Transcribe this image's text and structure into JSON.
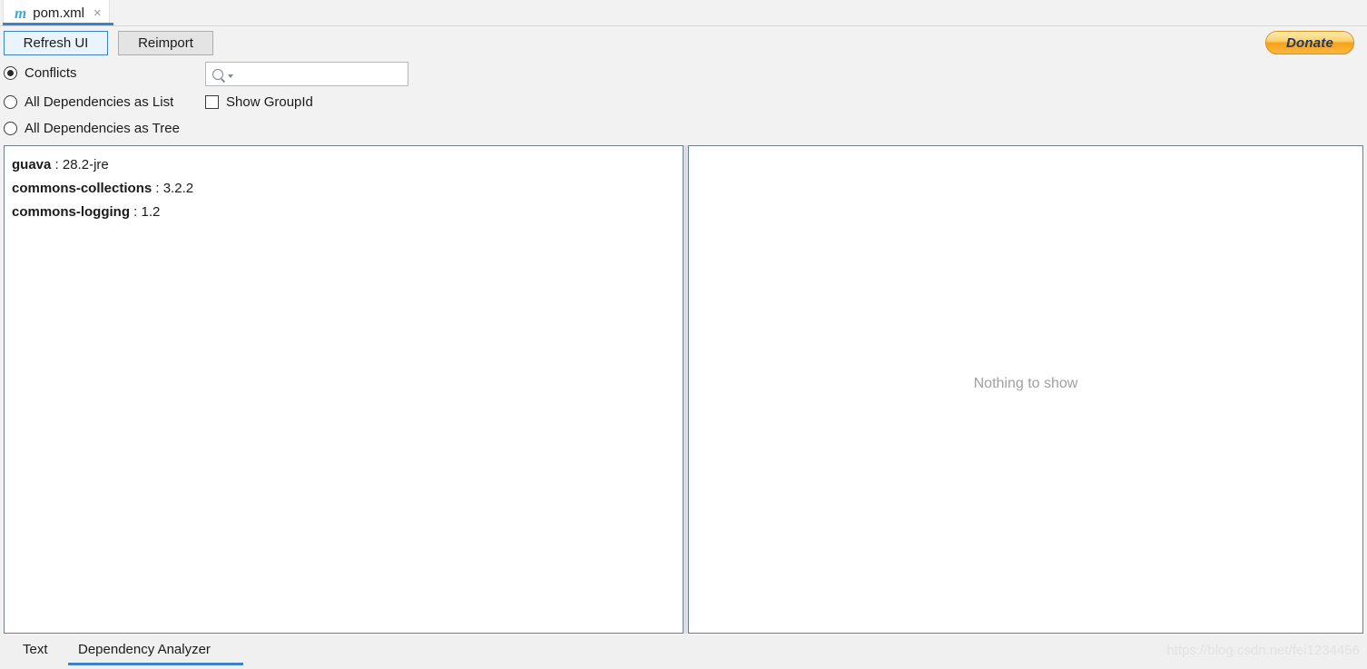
{
  "editor": {
    "tab": {
      "icon": "maven-m-icon",
      "icon_glyph": "m",
      "title": "pom.xml",
      "close_glyph": "×"
    }
  },
  "toolbar": {
    "refresh_label": "Refresh UI",
    "reimport_label": "Reimport",
    "donate_label": "Donate"
  },
  "options": {
    "radios": [
      {
        "label": "Conflicts",
        "selected": true
      },
      {
        "label": "All Dependencies as List",
        "selected": false
      },
      {
        "label": "All Dependencies as Tree",
        "selected": false
      }
    ],
    "checkbox": {
      "label": "Show GroupId",
      "checked": false
    },
    "search": {
      "value": "",
      "placeholder": ""
    }
  },
  "left_panel": {
    "dependencies": [
      {
        "artifact": "guava",
        "separator": " : ",
        "version": "28.2-jre"
      },
      {
        "artifact": "commons-collections",
        "separator": " : ",
        "version": "3.2.2"
      },
      {
        "artifact": "commons-logging",
        "separator": " : ",
        "version": "1.2"
      }
    ]
  },
  "right_panel": {
    "empty_message": "Nothing to show"
  },
  "bottom_tabs": [
    {
      "label": "Text",
      "active": false
    },
    {
      "label": "Dependency Analyzer",
      "active": true
    }
  ],
  "watermark": "https://blog.csdn.net/fei1234456",
  "colors": {
    "accent_blue": "#3c82c8",
    "panel_border": "#6e7f91",
    "toolbar_bg": "#f2f2f2",
    "donate_orange": "#f9a117",
    "donate_text": "#1b3a6b",
    "empty_text": "#a0a0a0"
  }
}
